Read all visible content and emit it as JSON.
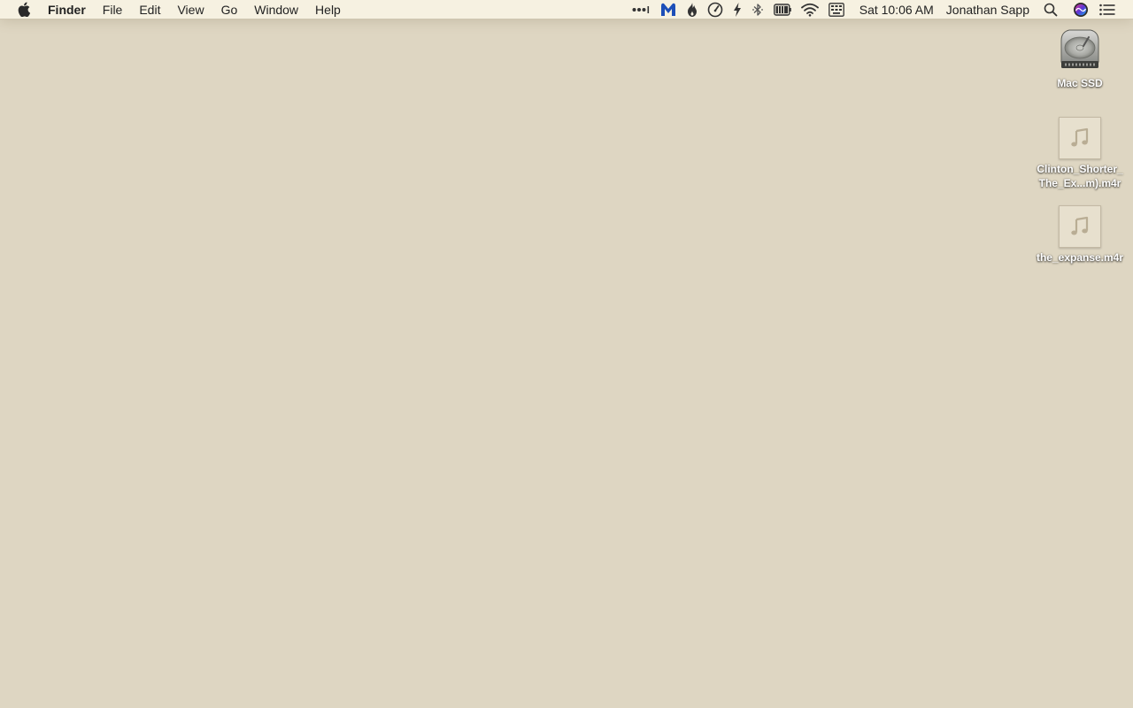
{
  "menubar": {
    "apple_icon": "apple-logo-icon",
    "app_name": "Finder",
    "menus": [
      "File",
      "Edit",
      "View",
      "Go",
      "Window",
      "Help"
    ],
    "status_icons": [
      "overflow-dots-icon",
      "malwarebytes-icon",
      "flame-icon",
      "speedometer-icon",
      "lightning-icon",
      "bluetooth-icon",
      "battery-icon",
      "wifi-icon",
      "keyboard-layout-icon"
    ],
    "clock": "Sat 10:06 AM",
    "user": "Jonathan Sapp",
    "spotlight_icon": "spotlight-search-icon",
    "siri_icon": "siri-icon",
    "notification_center_icon": "notification-center-icon"
  },
  "desktop": {
    "background_color": "#ded6c2",
    "icons": [
      {
        "label": "Mac SSD",
        "kind": "hard-drive-icon"
      },
      {
        "label": "Clinton_Shorter_\nThe_Ex...m).m4r",
        "kind": "music-file-icon"
      },
      {
        "label": "the_expanse.m4r",
        "kind": "music-file-icon"
      }
    ]
  }
}
